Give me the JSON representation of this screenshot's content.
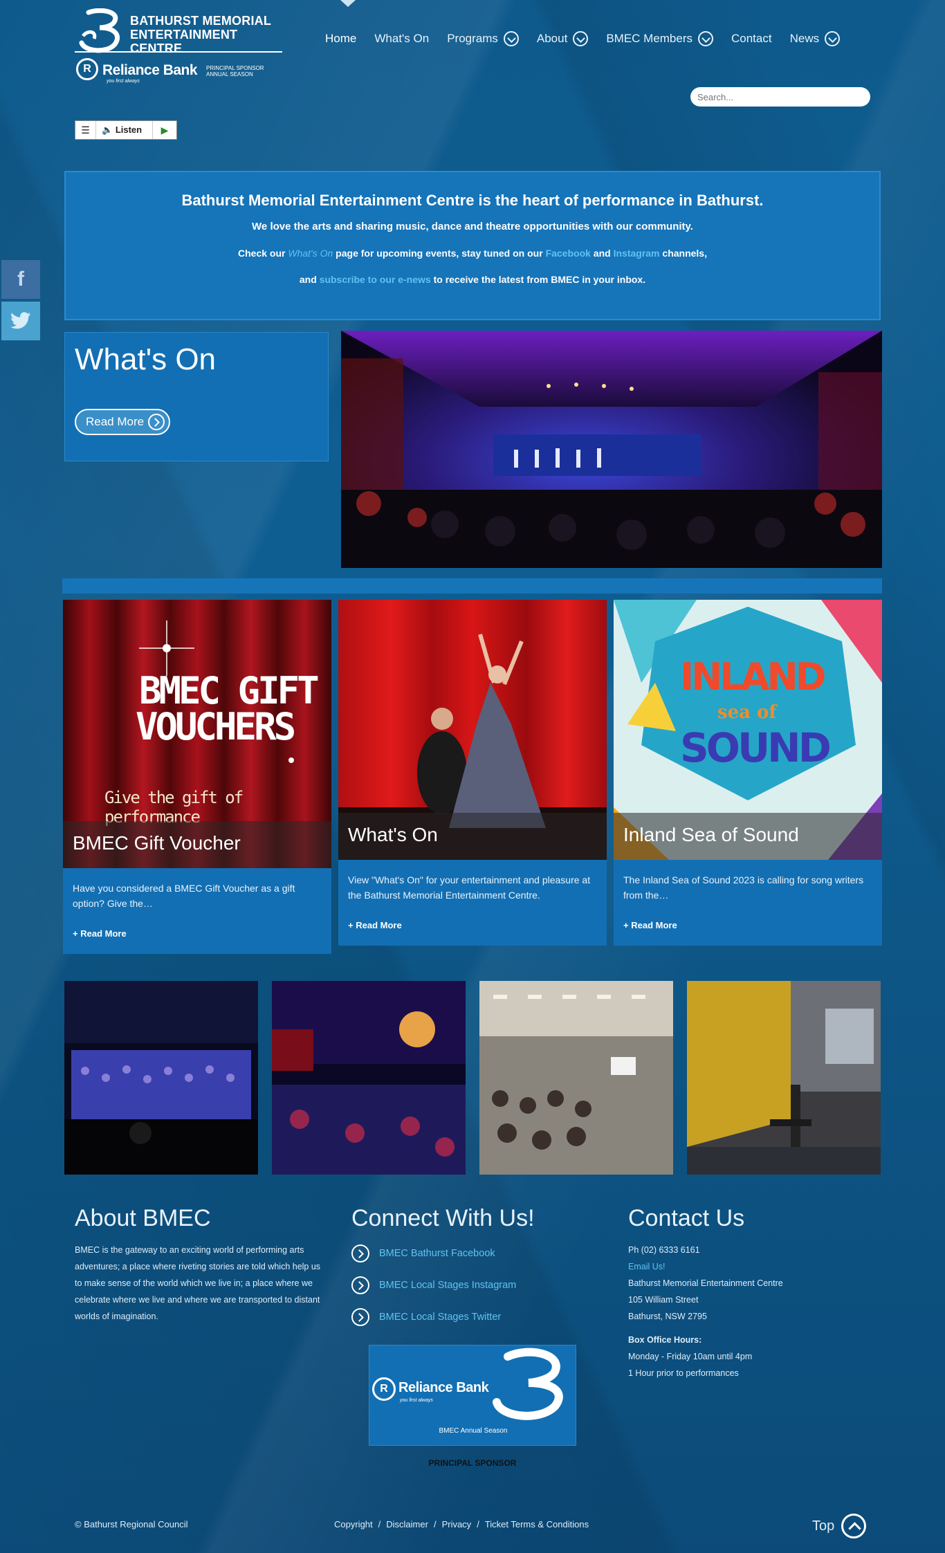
{
  "header": {
    "org_name_line1": "BATHURST MEMORIAL",
    "org_name_line2": "ENTERTAINMENT CENTRE",
    "sponsor_name": "Reliance Bank",
    "sponsor_tagline": "you first always",
    "sponsor_note_line1": "PRINCIPAL SPONSOR",
    "sponsor_note_line2": "ANNUAL SEASON"
  },
  "nav": {
    "items": [
      {
        "label": "Home",
        "has_dropdown": false
      },
      {
        "label": "What's On",
        "has_dropdown": false
      },
      {
        "label": "Programs",
        "has_dropdown": true
      },
      {
        "label": "About",
        "has_dropdown": true
      },
      {
        "label": "BMEC Members",
        "has_dropdown": true
      },
      {
        "label": "Contact",
        "has_dropdown": false
      },
      {
        "label": "News",
        "has_dropdown": true
      }
    ]
  },
  "search": {
    "placeholder": "Search..."
  },
  "listen": {
    "label": "Listen",
    "menu_icon": "menu-icon",
    "play_icon": "play-icon"
  },
  "social": {
    "facebook_icon": "f",
    "twitter_icon": "twitter-bird"
  },
  "banner": {
    "heading": "Bathurst Memorial Entertainment Centre is the heart of performance in Bathurst.",
    "line2": "We love the arts and sharing music, dance and theatre opportunities with our community.",
    "line3_a": "Check our ",
    "line3_link1": "What's On",
    "line3_b": " page for upcoming events, stay tuned on our ",
    "line3_link2": "Facebook",
    "line3_c": " and ",
    "line3_link3": "Instagram",
    "line3_d": " channels,",
    "line4_a": "and ",
    "line4_link": "subscribe to our e-news",
    "line4_b": " to receive the latest from BMEC in your inbox."
  },
  "whats_on": {
    "title": "What's On",
    "button": "Read More"
  },
  "cards": [
    {
      "image_title_1": "BMEC GIFT",
      "image_title_2": "VOUCHERS",
      "image_sub": "Give the gift of performance",
      "caption": "BMEC Gift Voucher",
      "text": "Have you considered a BMEC Gift Voucher as a gift option? Give the…",
      "more": "Read More"
    },
    {
      "caption": "What's On",
      "text": "View \"What's On\" for your entertainment and pleasure at the Bathurst Memorial Entertainment Centre.",
      "more": "Read More"
    },
    {
      "image_title_1": "INLAND",
      "image_title_2": "sea of",
      "image_title_3": "SOUND",
      "caption": "Inland Sea of Sound",
      "text": "The Inland Sea of Sound 2023 is calling for song writers from the…",
      "more": "Read More"
    }
  ],
  "footer": {
    "about_title": "About BMEC",
    "about_text": "BMEC is the gateway to an exciting world of performing arts adventures; a place where riveting stories are told which help us to make sense of the world which we live in; a place where we celebrate where we live and where we are transported to distant worlds of imagination.",
    "connect_title": "Connect With Us!",
    "connect_links": [
      "BMEC Bathurst Facebook",
      "BMEC Local Stages Instagram",
      "BMEC Local Stages Twitter"
    ],
    "sponsor_card_name": "Reliance Bank",
    "sponsor_card_tag": "you first always",
    "sponsor_card_note": "BMEC Annual Season",
    "sponsor_caption": "PRINCIPAL SPONSOR",
    "contact_title": "Contact Us",
    "phone": "Ph (02) 6333 6161",
    "email": "Email Us!",
    "address1": "Bathurst Memorial Entertainment Centre",
    "address2": "105 William Street",
    "address3": "Bathurst, NSW 2795",
    "hours_label": "Box Office Hours:",
    "hours1": "Monday - Friday 10am until 4pm",
    "hours2": "1 Hour prior to performances",
    "copyright": "© Bathurst Regional Council",
    "links": [
      "Copyright",
      "Disclaimer",
      "Privacy",
      "Ticket Terms & Conditions"
    ],
    "top_label": "Top"
  },
  "colors": {
    "accent": "#5fc3f2",
    "panel": "#136fb3",
    "banner": "#1674b9"
  }
}
